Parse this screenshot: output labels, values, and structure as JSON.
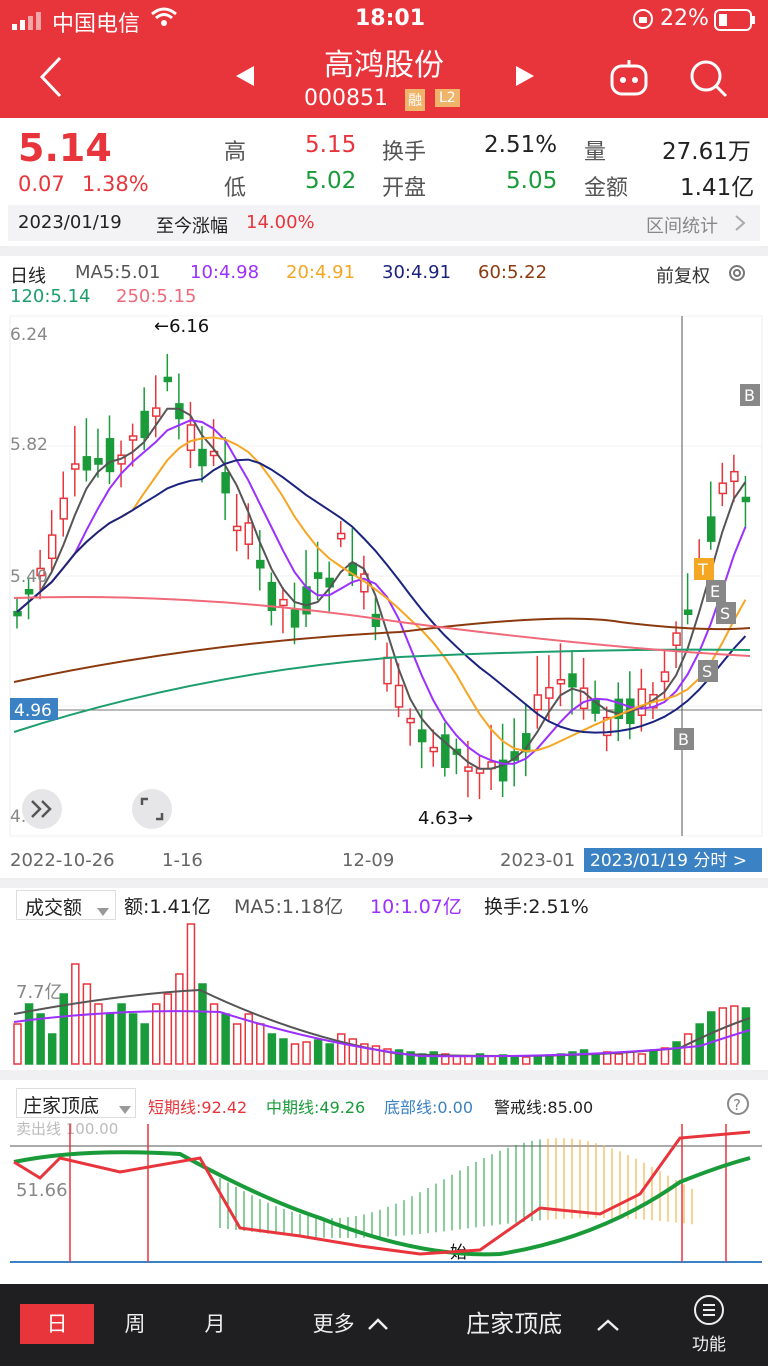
{
  "status": {
    "carrier": "中国电信",
    "time": "18:01",
    "battery": "22%"
  },
  "header": {
    "title": "高鸿股份",
    "code": "000851",
    "badge_rong": "融",
    "badge_l2": "L2"
  },
  "quote": {
    "price": "5.14",
    "change": "0.07",
    "change_pct": "1.38%",
    "high_label": "高",
    "high": "5.15",
    "low_label": "低",
    "low": "5.02",
    "turnover_label": "换手",
    "turnover": "2.51%",
    "open_label": "开盘",
    "open": "5.05",
    "volume_label": "量",
    "volume": "27.61万",
    "amount_label": "金额",
    "amount": "1.41亿"
  },
  "range": {
    "date": "2023/01/19",
    "label": "至今涨幅",
    "value": "14.00%",
    "stats_button": "区间统计"
  },
  "kline": {
    "period": "日线",
    "adjust": "前复权",
    "ma": {
      "ma5": "MA5:5.01",
      "ma10": "10:4.98",
      "ma20": "20:4.91",
      "ma30": "30:4.91",
      "ma60": "60:5.22",
      "ma120": "120:5.14",
      "ma250": "250:5.15"
    },
    "y_labels": [
      "6.24",
      "5.82",
      "5.40",
      "4.5"
    ],
    "current_price_tag": "4.96",
    "high_mark": "←6.16",
    "low_mark": "4.63→",
    "x_labels": [
      "2022-10-26",
      "1-16",
      "12-09",
      "2023-01"
    ],
    "cursor_tag": "2023/01/19 分时 >",
    "signals": {
      "b": "B",
      "s": "S",
      "t": "T",
      "e": "E"
    },
    "colors": {
      "up": "#e8353c",
      "down": "#1a9b3a",
      "ma5": "#555555",
      "ma10": "#9b30ff",
      "ma20": "#f5a623",
      "ma30": "#1a237e",
      "ma60": "#8b3a0f",
      "ma120": "#1e9e6e",
      "ma250": "#f06a7a"
    }
  },
  "volume_panel": {
    "title": "成交额",
    "amount": "额:1.41亿",
    "ma5": "MA5:1.18亿",
    "ma10": "10:1.07亿",
    "turnover": "换手:2.51%",
    "y_label": "7.7亿"
  },
  "indicator": {
    "title": "庄家顶底",
    "short": "短期线:92.42",
    "mid": "中期线:49.26",
    "bottom": "底部线:0.00",
    "alert": "警戒线:85.00",
    "sell_line": "卖出线 100.00",
    "y_label": "51.66",
    "start_mark": "始"
  },
  "bottom": {
    "tab_day": "日",
    "tab_week": "周",
    "tab_month": "月",
    "more": "更多",
    "indicator_name": "庄家顶底",
    "function": "功能"
  }
}
